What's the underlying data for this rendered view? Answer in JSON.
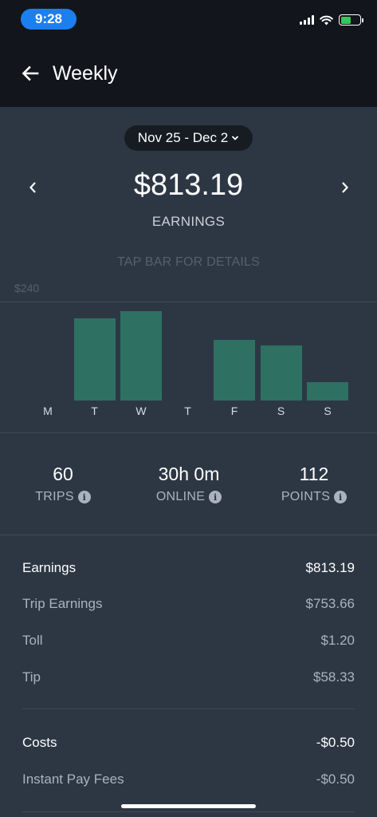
{
  "status_bar": {
    "time": "9:28",
    "battery_level": 0.55
  },
  "header": {
    "title": "Weekly",
    "back_icon": "arrow-left-icon"
  },
  "summary": {
    "date_range": "Nov 25 - Dec 2",
    "amount": "$813.19",
    "amount_label": "EARNINGS",
    "tap_hint": "TAP BAR FOR DETAILS"
  },
  "chart_data": {
    "type": "bar",
    "categories": [
      "M",
      "T",
      "W",
      "T",
      "F",
      "S",
      "S"
    ],
    "values": [
      0,
      199,
      217,
      0,
      148,
      134,
      45
    ],
    "ylabel": "",
    "y_tick_label": "$240",
    "ylim": [
      0,
      240
    ],
    "color": "#2e7163"
  },
  "stats": [
    {
      "value": "60",
      "label": "TRIPS"
    },
    {
      "value": "30h 0m",
      "label": "ONLINE"
    },
    {
      "value": "112",
      "label": "POINTS"
    }
  ],
  "breakdown": {
    "earnings": {
      "label": "Earnings",
      "value": "$813.19"
    },
    "trip_earnings": {
      "label": "Trip Earnings",
      "value": "$753.66"
    },
    "toll": {
      "label": "Toll",
      "value": "$1.20"
    },
    "tip": {
      "label": "Tip",
      "value": "$58.33"
    },
    "costs": {
      "label": "Costs",
      "value": "-$0.50"
    },
    "instant_pay_fees": {
      "label": "Instant Pay Fees",
      "value": "-$0.50"
    }
  }
}
